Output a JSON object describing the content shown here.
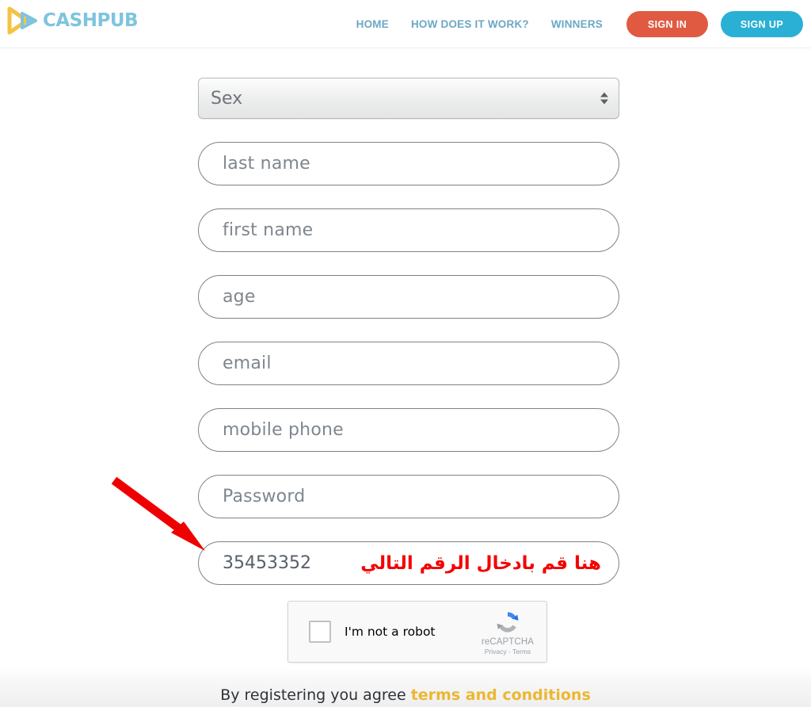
{
  "brand": {
    "name": "CASHPUB",
    "logo_colors": {
      "mark_yellow": "#f5c344",
      "mark_blue": "#7ec4de",
      "text": "#7ec4de"
    }
  },
  "nav": {
    "links": [
      {
        "label": "HOME"
      },
      {
        "label": "HOW DOES IT WORK?"
      },
      {
        "label": "WINNERS"
      }
    ],
    "sign_in": {
      "label": "SIGN IN",
      "color": "#e05a42"
    },
    "sign_up": {
      "label": "SIGN UP",
      "color": "#2ab0d4"
    },
    "link_color": "#6ba8c4"
  },
  "form": {
    "sex_select": {
      "value": "Sex"
    },
    "fields": [
      {
        "name": "last-name",
        "placeholder": "last name",
        "value": ""
      },
      {
        "name": "first-name",
        "placeholder": "first name",
        "value": ""
      },
      {
        "name": "age",
        "placeholder": "age",
        "value": ""
      },
      {
        "name": "email",
        "placeholder": "email",
        "value": ""
      },
      {
        "name": "mobile-phone",
        "placeholder": "mobile phone",
        "value": ""
      },
      {
        "name": "password",
        "placeholder": "Password",
        "value": ""
      }
    ],
    "code_field": {
      "name": "referral-code",
      "value": "35453352",
      "annotation_text": "هنا قم بادخال الرقم التالي",
      "annotation_color": "#f40000"
    }
  },
  "recaptcha": {
    "checkbox_label": "I'm not a robot",
    "brand": "reCAPTCHA",
    "legal": "Privacy - Terms"
  },
  "footer": {
    "prefix": "By registering you agree ",
    "terms_label": "terms and conditions",
    "terms_color": "#ecb731"
  },
  "annotation": {
    "arrow_color": "#ef0000"
  }
}
